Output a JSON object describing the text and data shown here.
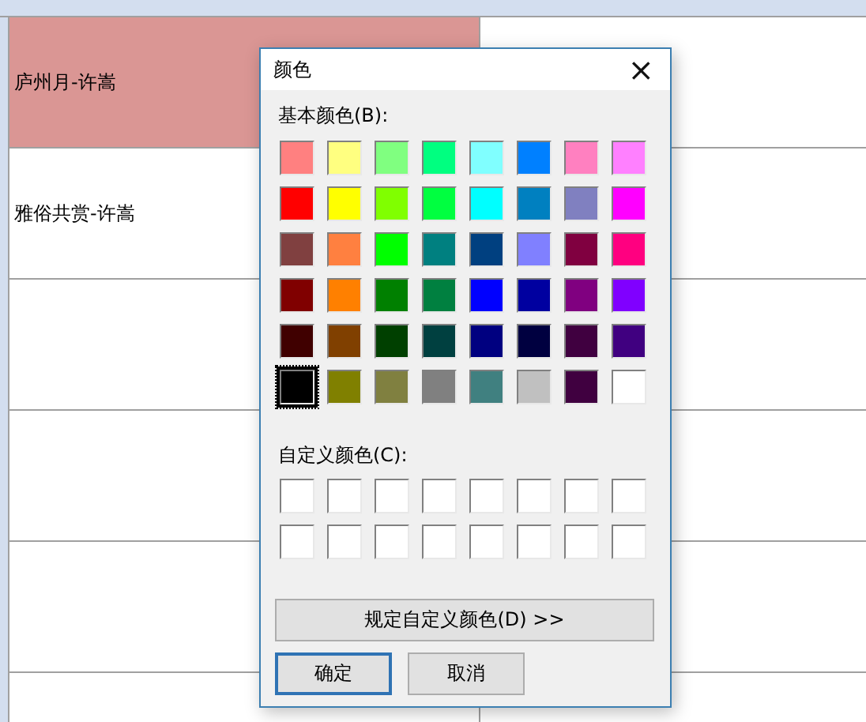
{
  "table": {
    "rows": [
      {
        "title": "庐州月-许嵩",
        "selected": true
      },
      {
        "title": "雅俗共赏-许嵩",
        "selected": false
      }
    ]
  },
  "dialog": {
    "title": "颜色",
    "close": "×",
    "basic_label": "基本颜色(B):",
    "basic_colors": [
      {
        "color": "#ff8080",
        "selected": false
      },
      {
        "color": "#ffff80",
        "selected": false
      },
      {
        "color": "#80ff80",
        "selected": false
      },
      {
        "color": "#00ff80",
        "selected": false
      },
      {
        "color": "#80ffff",
        "selected": false
      },
      {
        "color": "#0080ff",
        "selected": false
      },
      {
        "color": "#ff80c0",
        "selected": false
      },
      {
        "color": "#ff80ff",
        "selected": false
      },
      {
        "color": "#ff0000",
        "selected": false
      },
      {
        "color": "#ffff00",
        "selected": false
      },
      {
        "color": "#80ff00",
        "selected": false
      },
      {
        "color": "#00ff40",
        "selected": false
      },
      {
        "color": "#00ffff",
        "selected": false
      },
      {
        "color": "#0080c0",
        "selected": false
      },
      {
        "color": "#8080c0",
        "selected": false
      },
      {
        "color": "#ff00ff",
        "selected": false
      },
      {
        "color": "#804040",
        "selected": false
      },
      {
        "color": "#ff8040",
        "selected": false
      },
      {
        "color": "#00ff00",
        "selected": false
      },
      {
        "color": "#008080",
        "selected": false
      },
      {
        "color": "#004080",
        "selected": false
      },
      {
        "color": "#8080ff",
        "selected": false
      },
      {
        "color": "#800040",
        "selected": false
      },
      {
        "color": "#ff0080",
        "selected": false
      },
      {
        "color": "#800000",
        "selected": false
      },
      {
        "color": "#ff8000",
        "selected": false
      },
      {
        "color": "#008000",
        "selected": false
      },
      {
        "color": "#008040",
        "selected": false
      },
      {
        "color": "#0000ff",
        "selected": false
      },
      {
        "color": "#0000a0",
        "selected": false
      },
      {
        "color": "#800080",
        "selected": false
      },
      {
        "color": "#8000ff",
        "selected": false
      },
      {
        "color": "#400000",
        "selected": false
      },
      {
        "color": "#804000",
        "selected": false
      },
      {
        "color": "#004000",
        "selected": false
      },
      {
        "color": "#004040",
        "selected": false
      },
      {
        "color": "#000080",
        "selected": false
      },
      {
        "color": "#000040",
        "selected": false
      },
      {
        "color": "#400040",
        "selected": false
      },
      {
        "color": "#400080",
        "selected": false
      },
      {
        "color": "#000000",
        "selected": true
      },
      {
        "color": "#808000",
        "selected": false
      },
      {
        "color": "#808040",
        "selected": false
      },
      {
        "color": "#808080",
        "selected": false
      },
      {
        "color": "#408080",
        "selected": false
      },
      {
        "color": "#c0c0c0",
        "selected": false
      },
      {
        "color": "#400040",
        "selected": false
      },
      {
        "color": "#ffffff",
        "selected": false
      }
    ],
    "custom_label": "自定义颜色(C):",
    "custom_colors": [
      {
        "color": "#ffffff"
      },
      {
        "color": "#ffffff"
      },
      {
        "color": "#ffffff"
      },
      {
        "color": "#ffffff"
      },
      {
        "color": "#ffffff"
      },
      {
        "color": "#ffffff"
      },
      {
        "color": "#ffffff"
      },
      {
        "color": "#ffffff"
      },
      {
        "color": "#ffffff"
      },
      {
        "color": "#ffffff"
      },
      {
        "color": "#ffffff"
      },
      {
        "color": "#ffffff"
      },
      {
        "color": "#ffffff"
      },
      {
        "color": "#ffffff"
      },
      {
        "color": "#ffffff"
      },
      {
        "color": "#ffffff"
      }
    ],
    "define_button": "规定自定义颜色(D) >>",
    "buttons": [
      {
        "label": "确定",
        "default": true
      },
      {
        "label": "取消",
        "default": false
      }
    ]
  }
}
